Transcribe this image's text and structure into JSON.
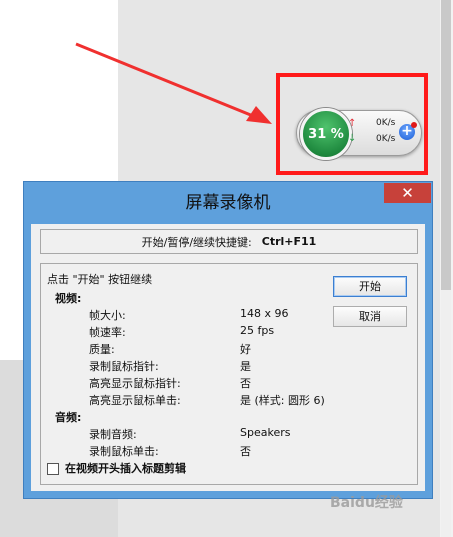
{
  "network_widget": {
    "percent": "31 %",
    "upload_speed": "0K/s",
    "download_speed": "0K/s",
    "up_arrow": "↑",
    "down_arrow": "↓",
    "plus_icon": "+"
  },
  "dialog": {
    "title": "屏幕录像机",
    "close_icon": "✕",
    "hotkey_label": "开始/暂停/继续快捷键:",
    "hotkey_value": "Ctrl+F11",
    "hint": "点击 \"开始\" 按钮继续",
    "start_button": "开始",
    "cancel_button": "取消",
    "video_section": "视频:",
    "video_settings": [
      {
        "label": "帧大小:",
        "value": "148 x 96"
      },
      {
        "label": "帧速率:",
        "value": "25 fps"
      },
      {
        "label": "质量:",
        "value": "好"
      },
      {
        "label": "录制鼠标指针:",
        "value": "是"
      },
      {
        "label": "高亮显示鼠标指针:",
        "value": "否"
      },
      {
        "label": "高亮显示鼠标单击:",
        "value": "是 (样式: 圆形 6)"
      }
    ],
    "audio_section": "音频:",
    "audio_settings": [
      {
        "label": "录制音频:",
        "value": "Speakers"
      },
      {
        "label": "录制鼠标单击:",
        "value": "否"
      }
    ],
    "title_clip_checkbox": "在视频开头插入标题剪辑",
    "title_clip_checked": false
  },
  "watermark": "Baidu经验",
  "colors": {
    "highlight_red": "#ff1a1a",
    "dialog_frame": "#5ea0dc",
    "close_red": "#c7413a",
    "gauge_green": "#2a9b4a"
  }
}
